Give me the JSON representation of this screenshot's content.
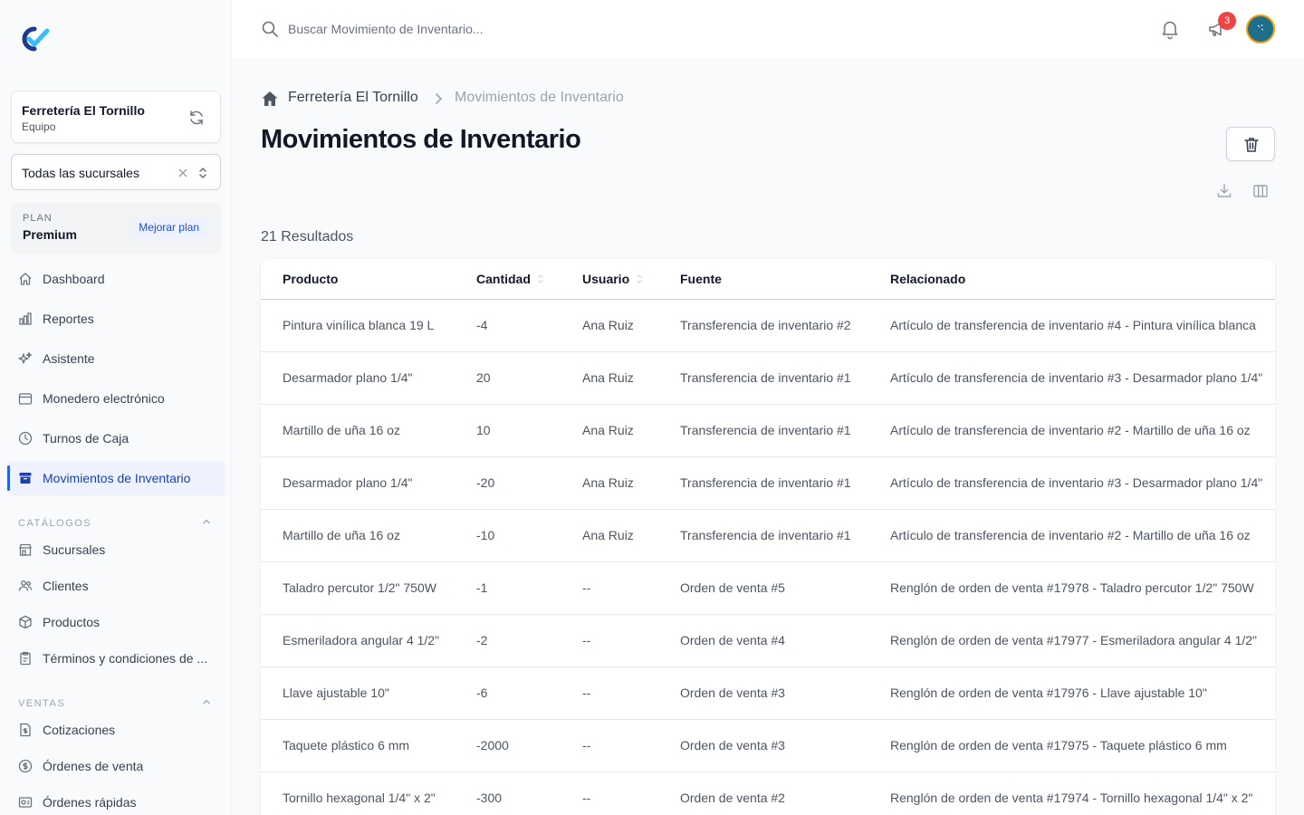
{
  "sidebar": {
    "team": {
      "name": "Ferretería El Tornillo",
      "role": "Equipo"
    },
    "branch_select": {
      "value": "Todas las sucursales"
    },
    "plan": {
      "caption": "PLAN",
      "name": "Premium",
      "upgrade_label": "Mejorar plan"
    },
    "nav": [
      {
        "label": "Dashboard",
        "icon": "home-icon"
      },
      {
        "label": "Reportes",
        "icon": "chart-bar-icon"
      },
      {
        "label": "Asistente",
        "icon": "sparkles-icon"
      },
      {
        "label": "Monedero electrónico",
        "icon": "wallet-icon"
      },
      {
        "label": "Turnos de Caja",
        "icon": "clock-icon"
      },
      {
        "label": "Movimientos de Inventario",
        "icon": "archive-box-icon",
        "active": true
      }
    ],
    "catalogs": {
      "title": "CATÁLOGOS",
      "items": [
        {
          "label": "Sucursales",
          "icon": "storefront-icon"
        },
        {
          "label": "Clientes",
          "icon": "users-icon"
        },
        {
          "label": "Productos",
          "icon": "cube-icon"
        },
        {
          "label": "Términos y condiciones de ...",
          "icon": "clipboard-icon"
        }
      ]
    },
    "sales": {
      "title": "VENTAS",
      "items": [
        {
          "label": "Cotizaciones",
          "icon": "document-dollar-icon"
        },
        {
          "label": "Órdenes de venta",
          "icon": "currency-circle-icon"
        },
        {
          "label": "Órdenes rápidas",
          "icon": "receipt-icon"
        }
      ]
    }
  },
  "topbar": {
    "search_placeholder": "Buscar Movimiento de Inventario...",
    "notifications_badge": "3"
  },
  "main": {
    "breadcrumb": [
      "Ferretería El Tornillo",
      "Movimientos de Inventario"
    ],
    "title": "Movimientos de Inventario",
    "results": "21 Resultados",
    "table": {
      "headers": [
        "Producto",
        "Cantidad",
        "Usuario",
        "Fuente",
        "Relacionado"
      ],
      "rows": [
        [
          "Pintura vinílica blanca 19 L",
          "-4",
          "Ana Ruiz",
          "Transferencia de inventario #2",
          "Artículo de transferencia de inventario #4 - Pintura vinílica blanca"
        ],
        [
          "Desarmador plano 1/4\"",
          "20",
          "Ana Ruiz",
          "Transferencia de inventario #1",
          "Artículo de transferencia de inventario #3 - Desarmador plano 1/4\""
        ],
        [
          "Martillo de uña 16 oz",
          "10",
          "Ana Ruiz",
          "Transferencia de inventario #1",
          "Artículo de transferencia de inventario #2 - Martillo de uña 16 oz"
        ],
        [
          "Desarmador plano 1/4\"",
          "-20",
          "Ana Ruiz",
          "Transferencia de inventario #1",
          "Artículo de transferencia de inventario #3 - Desarmador plano 1/4\""
        ],
        [
          "Martillo de uña 16 oz",
          "-10",
          "Ana Ruiz",
          "Transferencia de inventario #1",
          "Artículo de transferencia de inventario #2 - Martillo de uña 16 oz"
        ],
        [
          "Taladro percutor 1/2\" 750W",
          "-1",
          "--",
          "Orden de venta #5",
          "Renglón de orden de venta #17978 - Taladro percutor 1/2\" 750W"
        ],
        [
          "Esmeriladora angular 4 1/2\"",
          "-2",
          "--",
          "Orden de venta #4",
          "Renglón de orden de venta #17977 - Esmeriladora angular 4 1/2\""
        ],
        [
          "Llave ajustable 10\"",
          "-6",
          "--",
          "Orden de venta #3",
          "Renglón de orden de venta #17976 - Llave ajustable 10\""
        ],
        [
          "Taquete plástico 6 mm",
          "-2000",
          "--",
          "Orden de venta #3",
          "Renglón de orden de venta #17975 - Taquete plástico 6 mm"
        ],
        [
          "Tornillo hexagonal 1/4\" x 2\"",
          "-300",
          "--",
          "Orden de venta #2",
          "Renglón de orden de venta #17974 - Tornillo hexagonal 1/4\" x 2\""
        ]
      ]
    }
  },
  "colors": {
    "accent": "#2563eb",
    "active_bg": "#eef2ff",
    "badge": "#ef4444"
  }
}
